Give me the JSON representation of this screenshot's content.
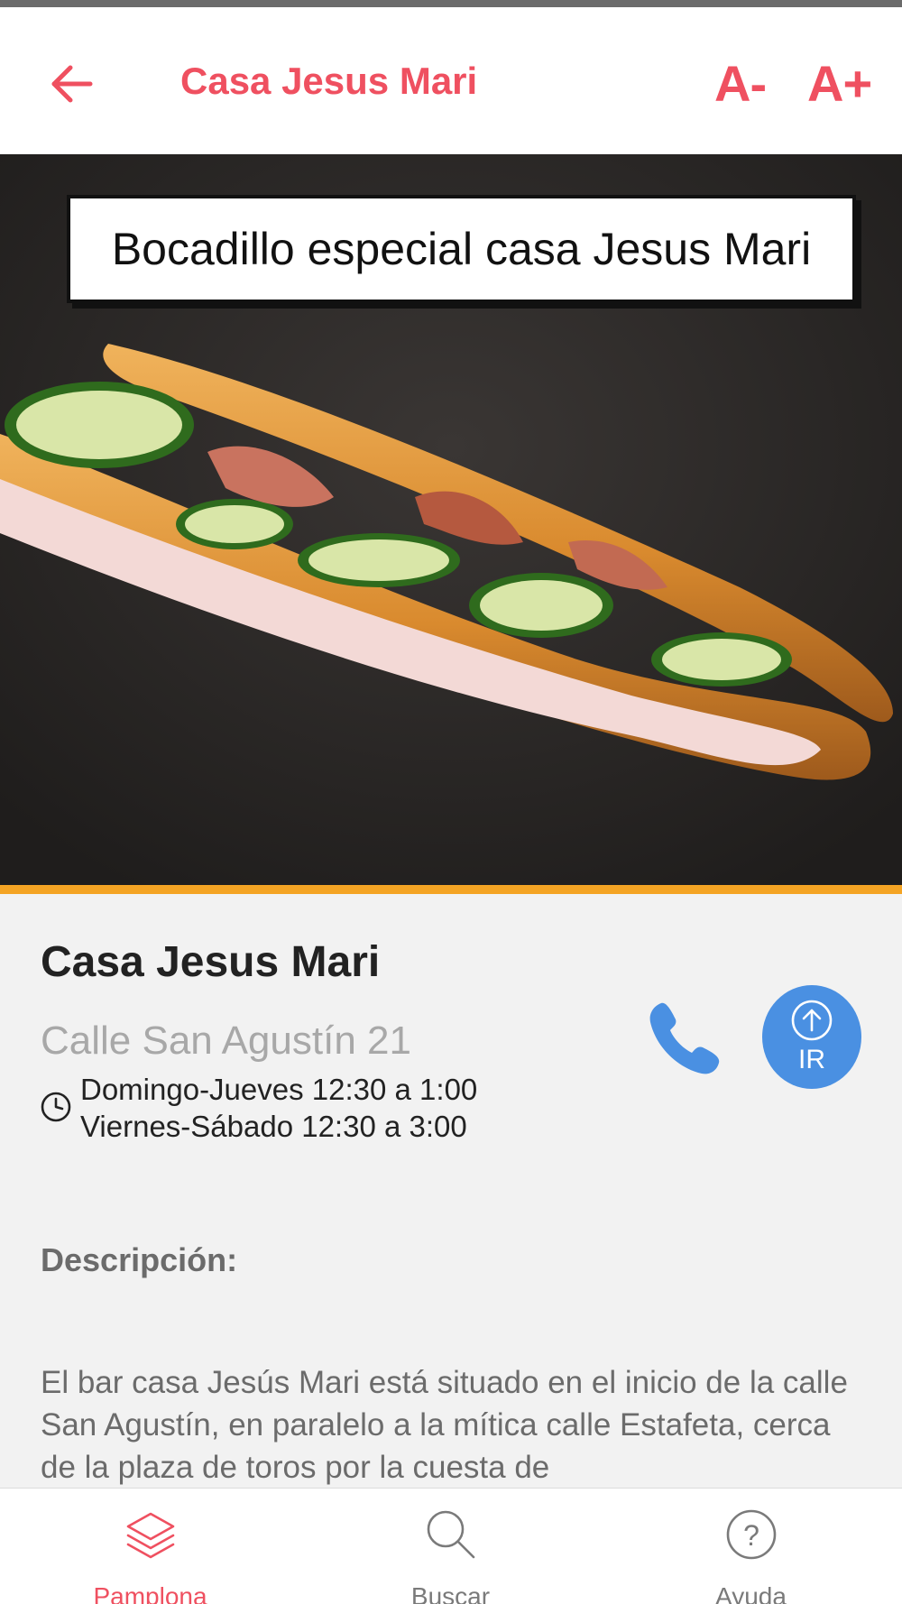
{
  "app_bar": {
    "title": "Casa Jesus Mari",
    "font_decrease_label": "A-",
    "font_increase_label": "A+",
    "accent_color": "#ef5060"
  },
  "hero": {
    "caption": "Bocadillo especial casa Jesus Mari"
  },
  "place": {
    "name": "Casa Jesus Mari",
    "address": "Calle San Agustín 21",
    "hours": [
      "Domingo-Jueves 12:30 a 1:00",
      "Viernes-Sábado 12:30 a 3:00"
    ],
    "go_label": "IR"
  },
  "description": {
    "heading": "Descripción:",
    "body": "El bar casa Jesús Mari está situado en el inicio de la calle San Agustín, en paralelo a la mítica calle Estafeta, cerca de la plaza de toros por la cuesta de"
  },
  "bottom_nav": [
    {
      "label": "Pamplona",
      "icon": "layers-icon",
      "active": true
    },
    {
      "label": "Buscar",
      "icon": "search-icon",
      "active": false
    },
    {
      "label": "Ayuda",
      "icon": "help-icon",
      "active": false
    }
  ],
  "colors": {
    "accent": "#ef5060",
    "divider": "#f4a424",
    "action_blue": "#4a90e2"
  }
}
